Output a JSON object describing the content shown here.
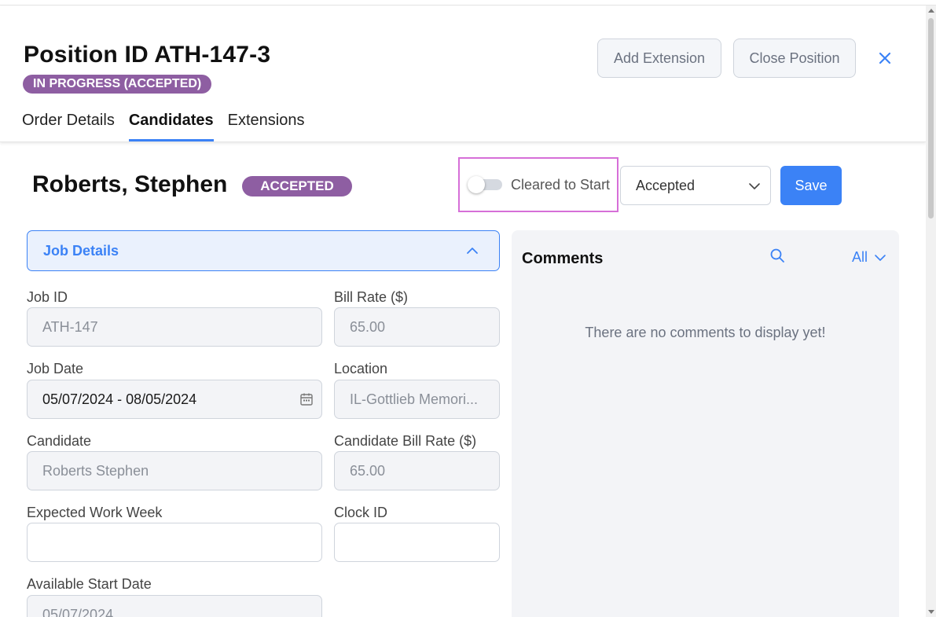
{
  "header": {
    "title": "Position ID ATH-147-3",
    "status": "IN PROGRESS (ACCEPTED)",
    "add_extension_label": "Add Extension",
    "close_position_label": "Close Position"
  },
  "tabs": [
    {
      "label": "Order Details",
      "active": false
    },
    {
      "label": "Candidates",
      "active": true
    },
    {
      "label": "Extensions",
      "active": false
    }
  ],
  "candidate": {
    "name": "Roberts, Stephen",
    "status": "ACCEPTED",
    "cleared_to_start_label": "Cleared to Start",
    "cleared_to_start": false,
    "status_select_value": "Accepted",
    "save_label": "Save"
  },
  "job_details": {
    "section_title": "Job Details",
    "fields": {
      "job_id": {
        "label": "Job ID",
        "value": "ATH-147"
      },
      "bill_rate": {
        "label": "Bill Rate ($)",
        "value": "65.00"
      },
      "job_date": {
        "label": "Job Date",
        "value": "05/07/2024 - 08/05/2024"
      },
      "location": {
        "label": "Location",
        "value": "IL-Gottlieb Memori..."
      },
      "candidate": {
        "label": "Candidate",
        "value": "Roberts Stephen"
      },
      "candidate_bill_rate": {
        "label": "Candidate Bill Rate ($)",
        "value": "65.00"
      },
      "expected_work_week": {
        "label": "Expected Work Week",
        "value": ""
      },
      "clock_id": {
        "label": "Clock ID",
        "value": ""
      },
      "available_start_date": {
        "label": "Available Start Date",
        "value": "05/07/2024"
      }
    }
  },
  "comments": {
    "title": "Comments",
    "filter_value": "All",
    "empty_message": "There are no comments to display yet!"
  },
  "colors": {
    "accent": "#3b82f6",
    "badge": "#8e5ea2",
    "highlight_border": "#d66fd8"
  }
}
